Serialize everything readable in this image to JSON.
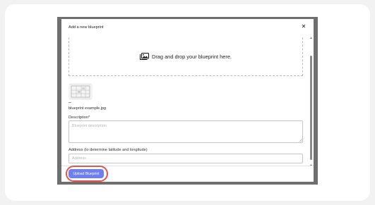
{
  "modal": {
    "title": "Add a new blueprint",
    "close_icon": "close-icon",
    "close_glyph": "✕"
  },
  "dropzone": {
    "icon": "images-icon",
    "text": "Drag and drop your blueprint here."
  },
  "file": {
    "thumbnail_icon": "blueprint-thumbnail",
    "name": "blueprint example.jpg"
  },
  "description": {
    "label": "Description*",
    "placeholder": "Blueprint description",
    "value": ""
  },
  "address": {
    "label": "Address (to determine latitude and longitude)",
    "placeholder": "Address",
    "value": ""
  },
  "scrollbar": {
    "up_glyph": "▲",
    "down_glyph": "▼"
  },
  "footer": {
    "upload_label": "Upload Blueprint"
  },
  "colors": {
    "backdrop": "#6f6f6f",
    "button": "#6f7ff0",
    "highlight": "#e0564b"
  }
}
